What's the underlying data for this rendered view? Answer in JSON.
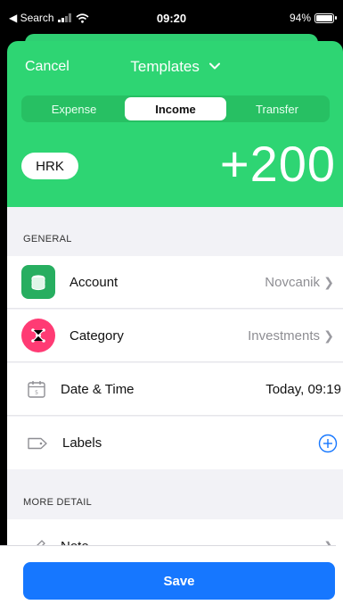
{
  "status": {
    "back_label": "◀ Search",
    "time": "09:20",
    "battery": "94%"
  },
  "header": {
    "cancel": "Cancel",
    "title": "Templates",
    "tabs": [
      "Expense",
      "Income",
      "Transfer"
    ],
    "active_tab": "Income",
    "currency": "HRK",
    "amount": "+200"
  },
  "general": {
    "section_title": "GENERAL",
    "account": {
      "label": "Account",
      "value": "Novcanik"
    },
    "category": {
      "label": "Category",
      "value": "Investments"
    },
    "datetime": {
      "label": "Date & Time",
      "value": "Today, 09:19"
    },
    "labels": {
      "label": "Labels"
    }
  },
  "more": {
    "section_title": "MORE DETAIL",
    "note": {
      "label": "Note"
    }
  },
  "save_label": "Save",
  "colors": {
    "header_green": "#2ed573",
    "account_icon": "#27ae60",
    "category_icon": "#ff3b74",
    "save_blue": "#1677ff"
  }
}
